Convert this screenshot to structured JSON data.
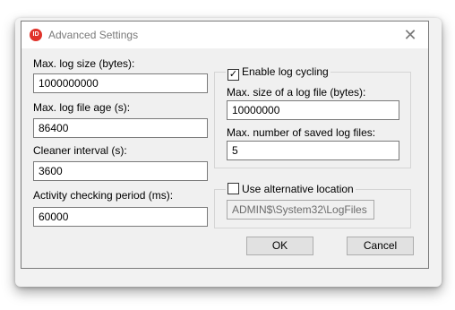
{
  "window": {
    "title": "Advanced Settings",
    "icon_text": "ID",
    "close_glyph": "✕"
  },
  "left": {
    "max_log_size": {
      "label": "Max. log size (bytes):",
      "value": "1000000000"
    },
    "max_log_file_age": {
      "label": "Max. log file age (s):",
      "value": "86400"
    },
    "cleaner_interval": {
      "label": "Cleaner interval (s):",
      "value": "3600"
    },
    "activity_checking_period": {
      "label": "Activity checking period (ms):",
      "value": "60000"
    }
  },
  "log_cycling": {
    "checkbox_label": "Enable log cycling",
    "checked": true,
    "check_glyph": "✓",
    "max_size": {
      "label": "Max. size of a log file (bytes):",
      "value": "10000000"
    },
    "max_saved": {
      "label": "Max. number of saved log files:",
      "value": "5"
    }
  },
  "alt_location": {
    "checkbox_label": "Use alternative location",
    "checked": false,
    "path_value": "ADMIN$\\System32\\LogFiles"
  },
  "buttons": {
    "ok": "OK",
    "cancel": "Cancel"
  }
}
